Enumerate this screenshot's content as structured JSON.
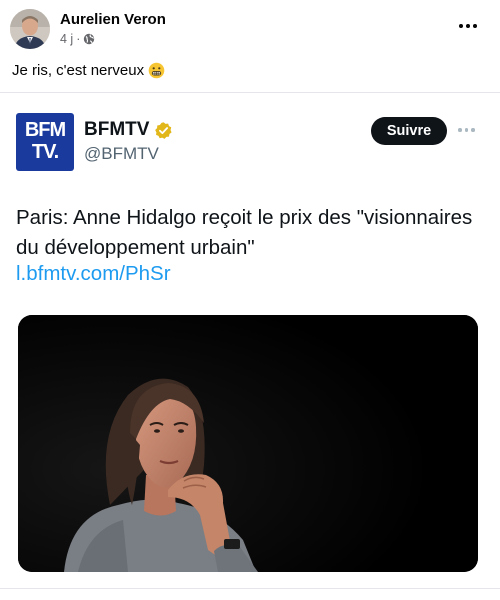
{
  "facebook_post": {
    "author": "Aurelien Veron",
    "time": "4 j",
    "separator": "·",
    "caption": "Je ris, c'est nerveux",
    "caption_emoji": "grimacing-face"
  },
  "embedded_tweet": {
    "logo_text_top": "BFM",
    "logo_text_bottom": "TV.",
    "display_name": "BFMTV",
    "handle": "@BFMTV",
    "verified": true,
    "follow_label": "Suivre",
    "text": "Paris: Anne Hidalgo reçoit le prix des \"visionnaires du développement urbain\"",
    "link": "l.bfmtv.com/PhSr",
    "media_description_icon": "photo"
  },
  "colors": {
    "link": "#1d9bf0",
    "bfm_blue": "#1a3a9e",
    "follow_button": "#0f1419",
    "verified_gold": "#e2b719",
    "meta_gray": "#65676b"
  }
}
